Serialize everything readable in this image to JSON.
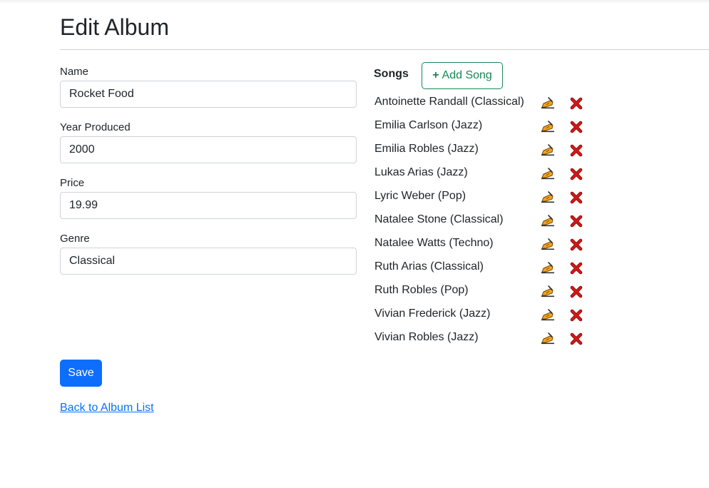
{
  "page": {
    "title": "Edit Album"
  },
  "form": {
    "name": {
      "label": "Name",
      "value": "Rocket Food"
    },
    "year": {
      "label": "Year Produced",
      "value": "2000"
    },
    "price": {
      "label": "Price",
      "value": "19.99"
    },
    "genre": {
      "label": "Genre",
      "value": "Classical"
    }
  },
  "songs": {
    "heading": "Songs",
    "add_button_icon": "plus-icon",
    "add_button_label": "Add Song",
    "edit_icon": "writing-hand-icon",
    "delete_icon": "red-x-icon",
    "items": [
      "Antoinette Randall (Classical)",
      "Emilia Carlson (Jazz)",
      "Emilia Robles (Jazz)",
      "Lukas Arias (Jazz)",
      "Lyric Weber (Pop)",
      "Natalee Stone (Classical)",
      "Natalee Watts (Techno)",
      "Ruth Arias (Classical)",
      "Ruth Robles (Pop)",
      "Vivian Frederick (Jazz)",
      "Vivian Robles (Jazz)"
    ]
  },
  "actions": {
    "save_label": "Save",
    "back_link_label": "Back to Album List"
  },
  "colors": {
    "primary": "#0d6efd",
    "success": "#198754",
    "delete": "#d11a1a",
    "edit": "#f3a21b"
  }
}
